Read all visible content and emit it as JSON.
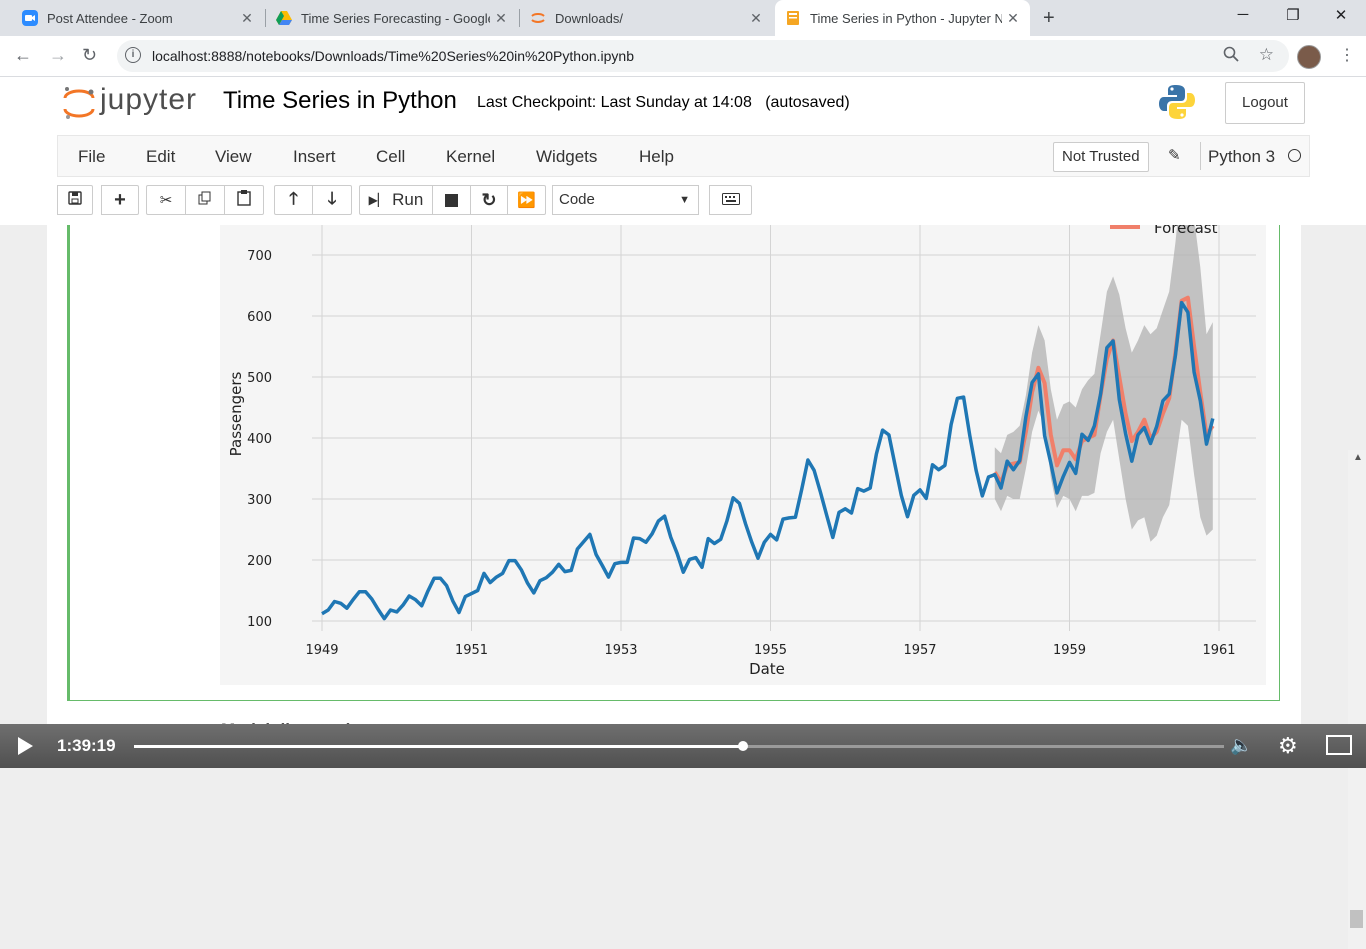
{
  "browser": {
    "tabs": [
      {
        "title": "Post Attendee - Zoom",
        "active": false,
        "favicon": "zoom-icon"
      },
      {
        "title": "Time Series Forecasting - Google",
        "active": false,
        "favicon": "google-drive-icon"
      },
      {
        "title": "Downloads/",
        "active": false,
        "favicon": "jupyter-icon"
      },
      {
        "title": "Time Series in Python - Jupyter N",
        "active": true,
        "favicon": "jupyter-notebook-icon"
      }
    ],
    "url": "localhost:8888/notebooks/Downloads/Time%20Series%20in%20Python.ipynb"
  },
  "jupyter": {
    "logo_text": "jupyter",
    "notebook_name": "Time Series in Python",
    "checkpoint": "Last Checkpoint: Last Sunday at 14:08",
    "autosave": "(autosaved)",
    "logout_label": "Logout",
    "menu": [
      "File",
      "Edit",
      "View",
      "Insert",
      "Cell",
      "Kernel",
      "Widgets",
      "Help"
    ],
    "trust_label": "Not Trusted",
    "kernel_name": "Python 3",
    "run_label": "Run",
    "cell_type": "Code"
  },
  "chart_data": {
    "type": "line",
    "xlabel": "Date",
    "ylabel": "Passengers",
    "x_ticks": [
      "1949",
      "1951",
      "1953",
      "1955",
      "1957",
      "1959",
      "1961"
    ],
    "y_ticks": [
      100,
      200,
      300,
      400,
      500,
      600,
      700
    ],
    "ylim": [
      85,
      740
    ],
    "legend": {
      "position": "top-right",
      "entries": [
        "Forecast"
      ]
    },
    "grid": true,
    "colors": {
      "observed": "#1f77b4",
      "forecast": "#f07f6a",
      "ci": "#b0b0b0"
    },
    "series": [
      {
        "name": "",
        "start": "1949-01",
        "frequency": "monthly",
        "values": [
          112,
          118,
          132,
          129,
          121,
          135,
          148,
          148,
          136,
          119,
          104,
          118,
          115,
          126,
          141,
          135,
          125,
          149,
          170,
          170,
          158,
          133,
          114,
          140,
          145,
          150,
          178,
          163,
          172,
          178,
          199,
          199,
          184,
          162,
          146,
          166,
          171,
          180,
          193,
          181,
          183,
          218,
          230,
          242,
          209,
          191,
          172,
          194,
          196,
          196,
          236,
          235,
          229,
          243,
          264,
          272,
          237,
          211,
          180,
          201,
          204,
          188,
          235,
          227,
          234,
          264,
          302,
          293,
          259,
          229,
          203,
          229,
          242,
          233,
          267,
          269,
          270,
          315,
          364,
          347,
          312,
          274,
          237,
          278,
          284,
          277,
          317,
          313,
          318,
          374,
          413,
          405,
          355,
          306,
          271,
          306,
          315,
          301,
          356,
          348,
          355,
          422,
          465,
          467,
          404,
          347,
          305,
          336,
          340,
          318,
          362,
          348,
          363,
          435,
          491,
          505,
          404,
          359,
          310,
          337,
          360,
          342,
          406,
          396,
          420,
          472,
          548,
          559,
          463,
          407,
          362,
          405,
          417,
          391,
          419,
          461,
          472,
          535,
          622,
          606,
          508,
          461,
          390,
          432
        ]
      },
      {
        "name": "Forecast",
        "start": "1958-01",
        "frequency": "monthly",
        "values": [
          344,
          327,
          355,
          358,
          360,
          410,
          475,
          515,
          490,
          405,
          355,
          380,
          380,
          365,
          395,
          400,
          405,
          470,
          530,
          560,
          500,
          440,
          395,
          410,
          430,
          400,
          410,
          440,
          465,
          540,
          625,
          630,
          550,
          475,
          405,
          420
        ],
        "ci_lower": [
          300,
          280,
          305,
          300,
          300,
          350,
          410,
          445,
          420,
          335,
          285,
          305,
          300,
          280,
          305,
          305,
          310,
          375,
          410,
          430,
          365,
          300,
          250,
          265,
          270,
          230,
          240,
          270,
          290,
          360,
          430,
          420,
          340,
          270,
          240,
          250
        ],
        "ci_upper": [
          385,
          375,
          405,
          410,
          420,
          470,
          540,
          585,
          560,
          480,
          430,
          455,
          460,
          450,
          480,
          495,
          505,
          570,
          640,
          665,
          635,
          580,
          540,
          560,
          585,
          570,
          580,
          610,
          640,
          720,
          820,
          840,
          760,
          680,
          570,
          590
        ]
      }
    ]
  },
  "next_cell_text": "Model diagnostics:",
  "video": {
    "time": "1:39:19",
    "progress": 0.56
  }
}
